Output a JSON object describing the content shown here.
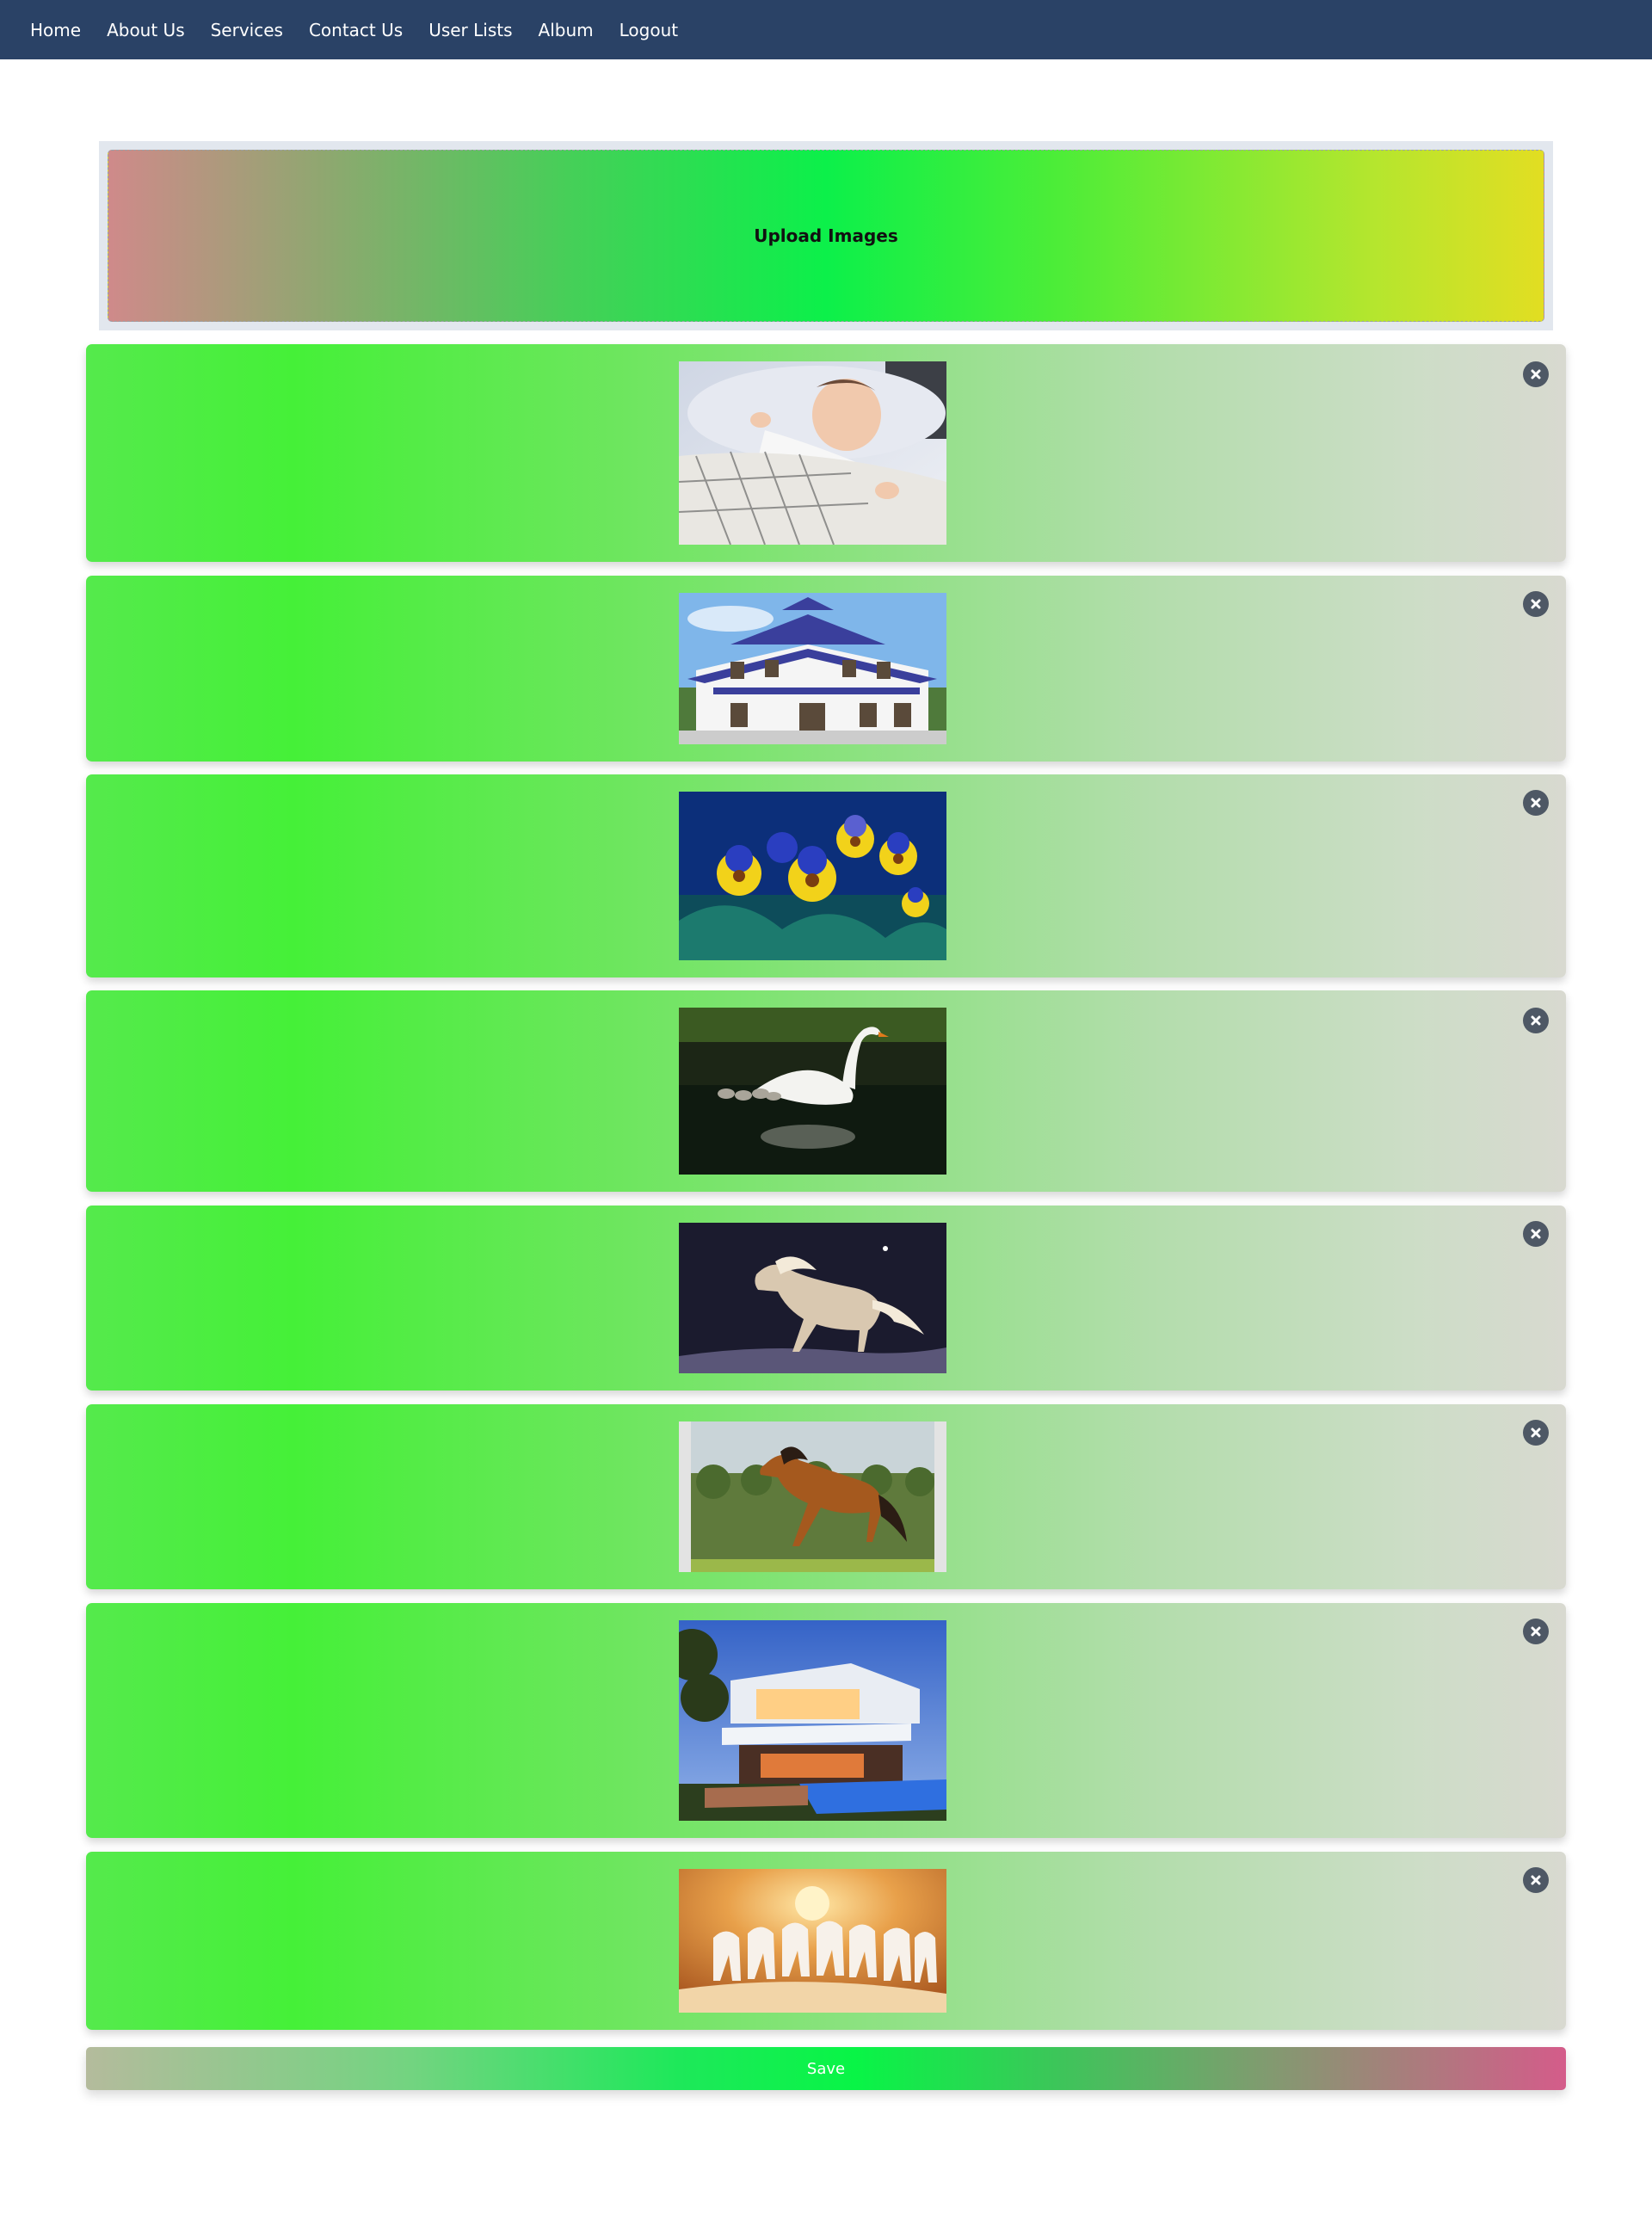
{
  "nav": {
    "items": [
      {
        "label": "Home"
      },
      {
        "label": "About Us"
      },
      {
        "label": "Services"
      },
      {
        "label": "Contact Us"
      },
      {
        "label": "User Lists"
      },
      {
        "label": "Album"
      },
      {
        "label": "Logout"
      }
    ]
  },
  "upload": {
    "label": "Upload Images"
  },
  "images": [
    {
      "subject": "sleeping-baby",
      "remove_icon": "close-circle-icon"
    },
    {
      "subject": "white-villa-blue-roof",
      "remove_icon": "close-circle-icon"
    },
    {
      "subject": "yellow-blue-pansies",
      "remove_icon": "close-circle-icon"
    },
    {
      "subject": "swan-with-cygnets",
      "remove_icon": "close-circle-icon"
    },
    {
      "subject": "white-horse-night",
      "remove_icon": "close-circle-icon"
    },
    {
      "subject": "bay-horse-galloping",
      "remove_icon": "close-circle-icon"
    },
    {
      "subject": "modern-house-pool",
      "remove_icon": "close-circle-icon"
    },
    {
      "subject": "seven-white-horses",
      "remove_icon": "close-circle-icon"
    }
  ],
  "save": {
    "label": "Save"
  },
  "colors": {
    "navbar": "#2a4266",
    "remove_icon": "#4e5865",
    "card_gradient_start": "#45f038",
    "card_gradient_end": "#d8d9d0"
  }
}
